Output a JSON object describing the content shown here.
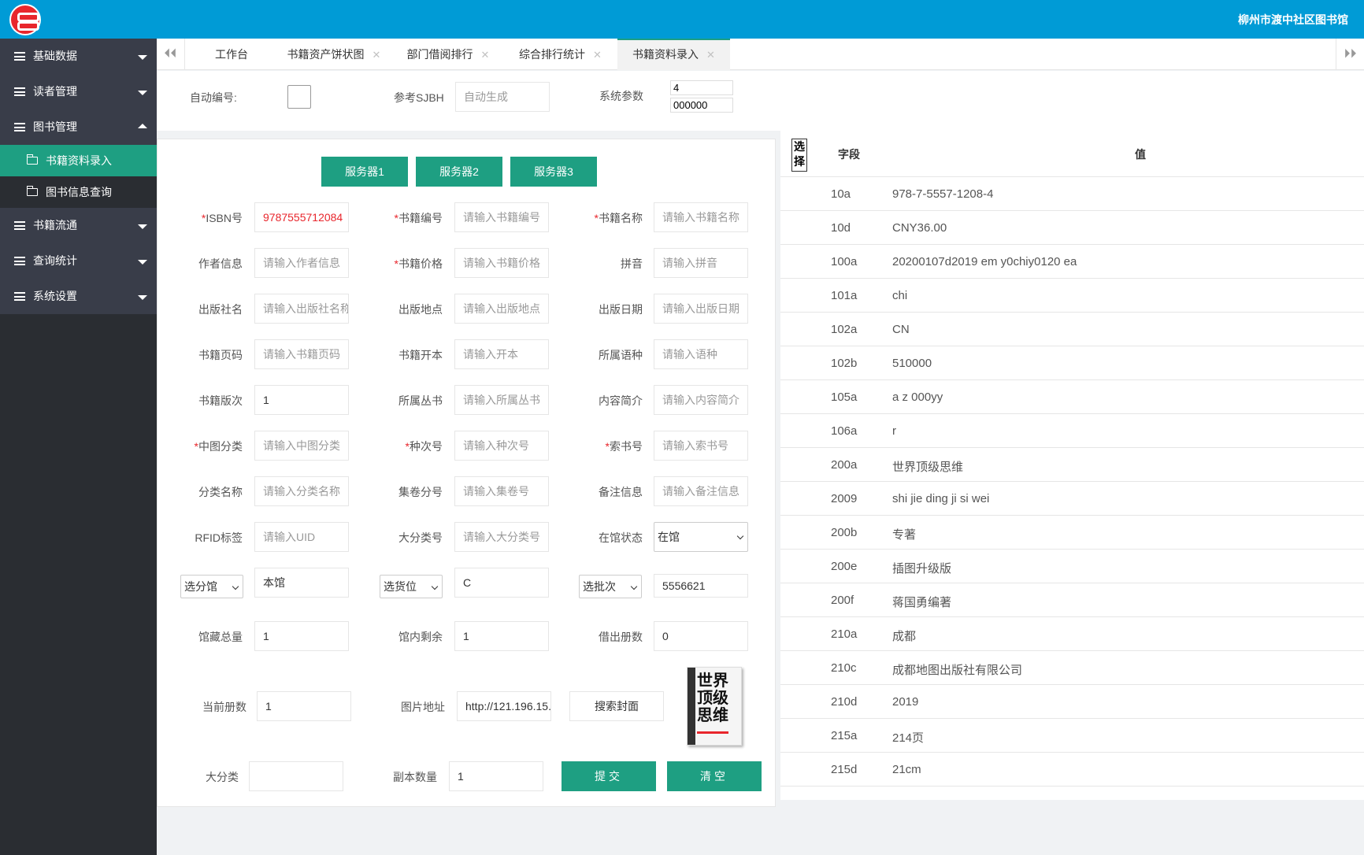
{
  "header": {
    "org_name": "柳州市渡中社区图书馆"
  },
  "sidebar": {
    "items": [
      {
        "label": "基础数据"
      },
      {
        "label": "读者管理"
      },
      {
        "label": "图书管理"
      },
      {
        "label": "书籍资料录入"
      },
      {
        "label": "图书信息查询"
      },
      {
        "label": "书籍流通"
      },
      {
        "label": "查询统计"
      },
      {
        "label": "系统设置"
      }
    ]
  },
  "tabs": {
    "prev": "⏴⏴",
    "next": "⏵⏵",
    "items": [
      {
        "label": "工作台"
      },
      {
        "label": "书籍资产饼状图"
      },
      {
        "label": "部门借阅排行"
      },
      {
        "label": "综合排行统计"
      },
      {
        "label": "书籍资料录入"
      }
    ],
    "close": "✕"
  },
  "params": {
    "auto_number_label": "自动编号:",
    "ref_label": "参考SJBH",
    "ref_placeholder": "自动生成",
    "sys_label": "系统参数",
    "sys_value1": "4",
    "sys_value2": "000000"
  },
  "servers": [
    "服务器1",
    "服务器2",
    "服务器3"
  ],
  "form": {
    "isbn": {
      "label": "ISBN号",
      "value": "9787555712084"
    },
    "book_no": {
      "label": "书籍编号",
      "placeholder": "请输入书籍编号"
    },
    "book_name": {
      "label": "书籍名称",
      "placeholder": "请输入书籍名称"
    },
    "author": {
      "label": "作者信息",
      "placeholder": "请输入作者信息"
    },
    "price": {
      "label": "书籍价格",
      "placeholder": "请输入书籍价格"
    },
    "pinyin": {
      "label": "拼音",
      "placeholder": "请输入拼音"
    },
    "publisher": {
      "label": "出版社名",
      "placeholder": "请输入出版社名称"
    },
    "pub_place": {
      "label": "出版地点",
      "placeholder": "请输入出版地点"
    },
    "pub_date": {
      "label": "出版日期",
      "placeholder": "请输入出版日期"
    },
    "pages": {
      "label": "书籍页码",
      "placeholder": "请输入书籍页码"
    },
    "format": {
      "label": "书籍开本",
      "placeholder": "请输入开本"
    },
    "language": {
      "label": "所属语种",
      "placeholder": "请输入语种"
    },
    "edition": {
      "label": "书籍版次",
      "value": "1"
    },
    "series": {
      "label": "所属丛书",
      "placeholder": "请输入所属丛书"
    },
    "summary": {
      "label": "内容简介",
      "placeholder": "请输入内容简介"
    },
    "clc": {
      "label": "中图分类",
      "placeholder": "请输入中图分类"
    },
    "kind_no": {
      "label": "种次号",
      "placeholder": "请输入种次号"
    },
    "call_no": {
      "label": "索书号",
      "placeholder": "请输入索书号"
    },
    "class_name": {
      "label": "分类名称",
      "placeholder": "请输入分类名称"
    },
    "volume_no": {
      "label": "集卷分号",
      "placeholder": "请输入集卷号"
    },
    "remark": {
      "label": "备注信息",
      "placeholder": "请输入备注信息"
    },
    "rfid": {
      "label": "RFID标签",
      "placeholder": "请输入UID"
    },
    "major_class_no": {
      "label": "大分类号",
      "placeholder": "请输入大分类号"
    },
    "status": {
      "label": "在馆状态",
      "value": "在馆"
    },
    "branch": {
      "select": "选分馆",
      "value": "本馆"
    },
    "shelf": {
      "select": "选货位",
      "value": "C"
    },
    "batch": {
      "select": "选批次",
      "value": "5556621"
    },
    "total": {
      "label": "馆藏总量",
      "value": "1"
    },
    "remain": {
      "label": "馆内剩余",
      "value": "1"
    },
    "borrowed": {
      "label": "借出册数",
      "value": "0"
    },
    "current": {
      "label": "当前册数",
      "value": "1"
    },
    "img_url": {
      "label": "图片地址",
      "value": "http://121.196.15."
    },
    "search_cover": "搜索封面",
    "major_class": {
      "label": "大分类",
      "value": ""
    },
    "copies": {
      "label": "副本数量",
      "value": "1"
    },
    "submit": "提交",
    "clear": "清空",
    "cover_text": "世界顶级思维"
  },
  "table": {
    "select_header": "选择",
    "col_field": "字段",
    "col_value": "值",
    "rows": [
      {
        "k": "10a",
        "v": "978-7-5557-1208-4"
      },
      {
        "k": "10d",
        "v": "CNY36.00"
      },
      {
        "k": "100a",
        "v": "20200107d2019 em y0chiy0120 ea"
      },
      {
        "k": "101a",
        "v": "chi"
      },
      {
        "k": "102a",
        "v": "CN"
      },
      {
        "k": "102b",
        "v": "510000"
      },
      {
        "k": "105a",
        "v": "a z 000yy"
      },
      {
        "k": "106a",
        "v": "r"
      },
      {
        "k": "200a",
        "v": "世界顶级思维"
      },
      {
        "k": "2009",
        "v": "shi jie ding ji si wei"
      },
      {
        "k": "200b",
        "v": "专著"
      },
      {
        "k": "200e",
        "v": "插图升级版"
      },
      {
        "k": "200f",
        "v": "蒋国勇编著"
      },
      {
        "k": "210a",
        "v": "成都"
      },
      {
        "k": "210c",
        "v": "成都地图出版社有限公司"
      },
      {
        "k": "210d",
        "v": "2019"
      },
      {
        "k": "215a",
        "v": "214页"
      },
      {
        "k": "215d",
        "v": "21cm"
      }
    ]
  }
}
